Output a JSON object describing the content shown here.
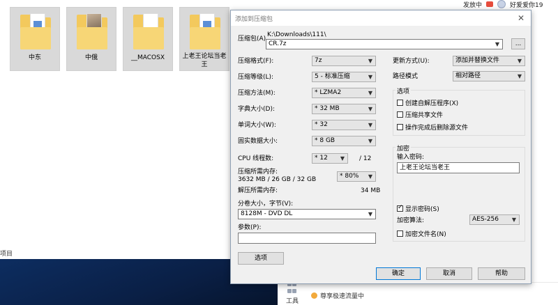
{
  "desktop": {
    "folders": [
      {
        "name": "中东",
        "kind": "blue"
      },
      {
        "name": "中俄",
        "kind": "photo"
      },
      {
        "name": "__MACOSX",
        "kind": "plain"
      },
      {
        "name": "上老王论坛当老王",
        "kind": "blue"
      }
    ],
    "left_edge_label": "项目",
    "top_right": {
      "text1": "发放中",
      "user": "好爱爱你19"
    },
    "tool_label": "工具",
    "vip_text": "尊享极速流量中"
  },
  "dialog": {
    "title": "添加到压缩包",
    "close_glyph": "✕",
    "archive_label": "压缩包(A)",
    "archive_path": "K:\\Downloads\\111\\",
    "archive_name": "CR.7z",
    "browse_label": "...",
    "format_label": "压缩格式(F):",
    "format_value": "7z",
    "level_label": "压缩等级(L):",
    "level_value": "5 - 标准压缩",
    "method_label": "压缩方法(M):",
    "method_value": "* LZMA2",
    "dict_label": "字典大小(D):",
    "dict_value": "* 32 MB",
    "word_label": "单词大小(W):",
    "word_value": "* 32",
    "solid_label": "固实数据大小:",
    "solid_value": "* 8 GB",
    "cpu_label": "CPU 线程数:",
    "cpu_value": "* 12",
    "cpu_total": "/ 12",
    "mem_comp_label": "压缩所需内存:",
    "mem_comp_detail": "3632 MB / 26 GB / 32 GB",
    "mem_percent": "* 80%",
    "mem_decomp_label": "解压所需内存:",
    "mem_decomp_value": "34 MB",
    "split_label": "分卷大小，字节(V):",
    "split_value": "8128M - DVD DL",
    "params_label": "参数(P):",
    "params_value": "",
    "options_button": "选项",
    "update_label": "更新方式(U):",
    "update_value": "添加并替换文件",
    "path_mode_label": "路径模式",
    "path_mode_value": "相对路径",
    "options_group": "选项",
    "opt_sfx": "创建自解压程序(X)",
    "opt_shared": "压缩共享文件",
    "opt_delete": "操作完成后删除源文件",
    "encrypt_group": "加密",
    "password_label": "输入密码:",
    "password_value": "上老王论坛当老王",
    "show_password": "显示密码(S)",
    "enc_method_label": "加密算法:",
    "enc_method_value": "AES-256",
    "encrypt_names": "加密文件名(N)",
    "ok": "确定",
    "cancel": "取消",
    "help": "帮助"
  }
}
